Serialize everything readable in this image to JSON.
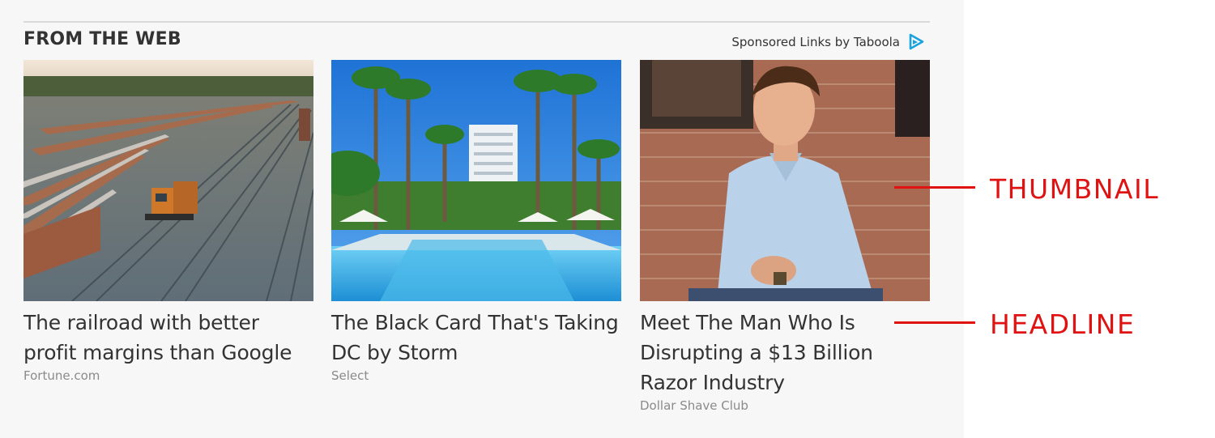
{
  "widget": {
    "title": "FROM THE WEB",
    "sponsor_label": "Sponsored Links by Taboola",
    "sponsor_icon": "taboola-logo-icon",
    "accent_color": "#1aa3e0"
  },
  "cards": [
    {
      "thumbnail": "railroad-yard-photo",
      "headline": "The railroad with better profit margins than Google",
      "source": "Fortune.com"
    },
    {
      "thumbnail": "resort-pool-palm-trees-photo",
      "headline": "The Black Card That's Taking DC by Storm",
      "source": "Select"
    },
    {
      "thumbnail": "man-brick-wall-photo",
      "headline": "Meet The Man Who Is Disrupting a $13 Billion Razor Industry",
      "source": "Dollar Shave Club"
    }
  ],
  "annotations": {
    "color": "#e01313",
    "thumbnail_label": "THUMBNAIL",
    "headline_label": "HEADLINE"
  }
}
